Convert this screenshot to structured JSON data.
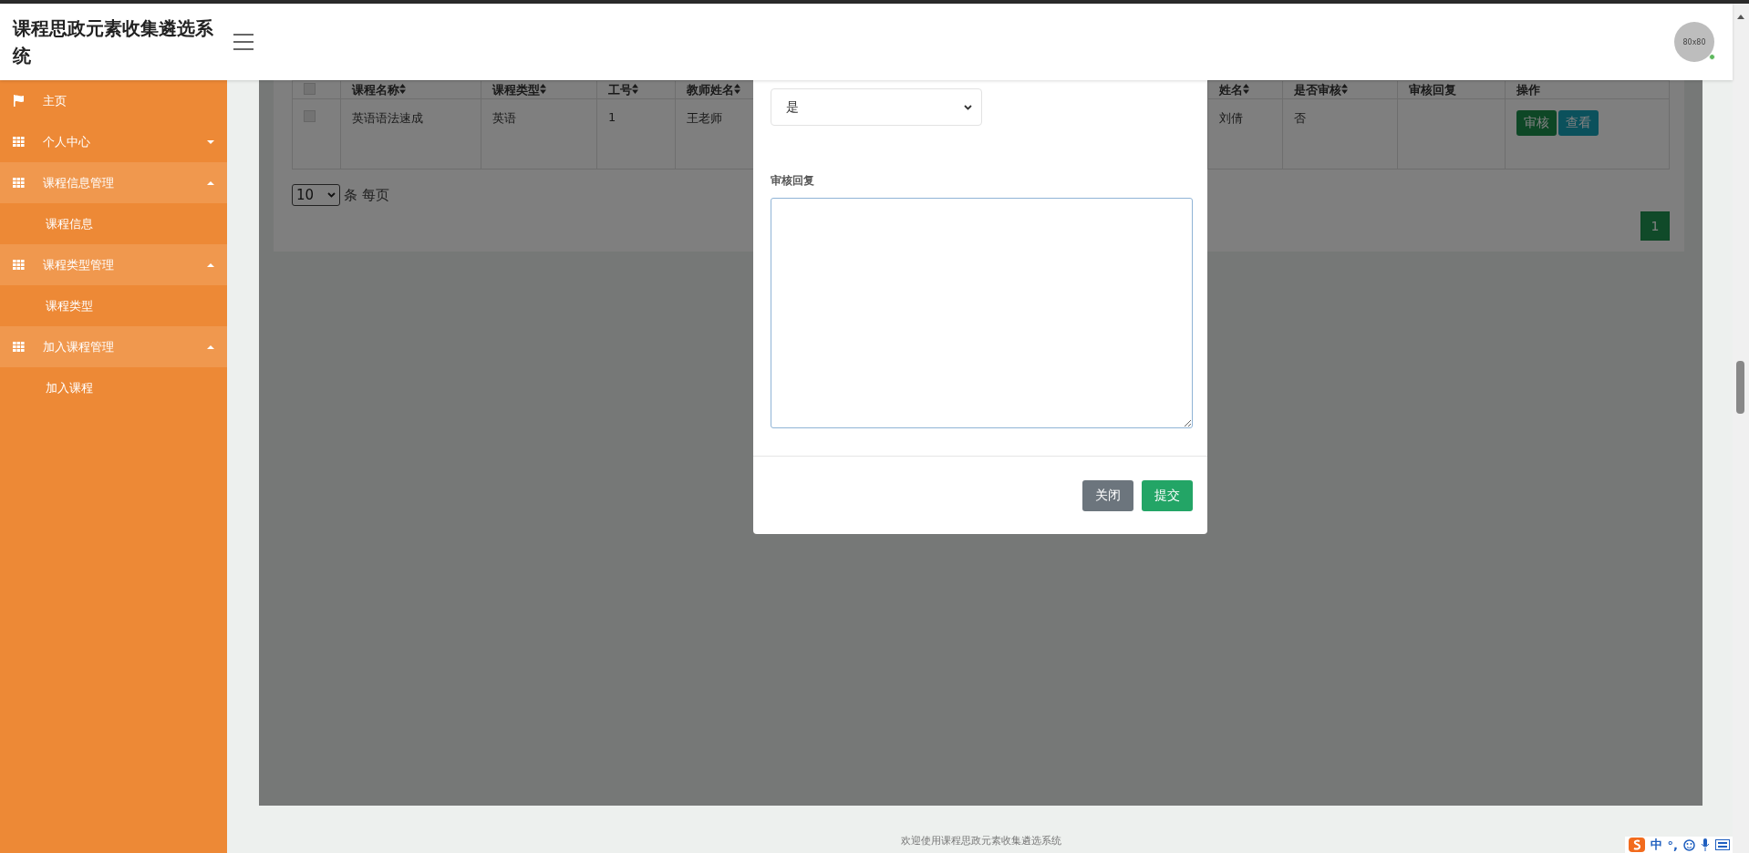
{
  "header": {
    "title": "课程思政元素收集遴选系统",
    "avatar": {
      "label": "80x80",
      "online": true
    }
  },
  "sidebar": {
    "items": [
      {
        "label": "主页",
        "kind": "home"
      },
      {
        "label": "个人中心",
        "kind": "group",
        "expanded": false
      },
      {
        "label": "课程信息管理",
        "kind": "group",
        "expanded": true,
        "children": [
          {
            "label": "课程信息"
          }
        ]
      },
      {
        "label": "课程类型管理",
        "kind": "group",
        "expanded": true,
        "children": [
          {
            "label": "课程类型"
          }
        ]
      },
      {
        "label": "加入课程管理",
        "kind": "group",
        "expanded": true,
        "children": [
          {
            "label": "加入课程"
          }
        ]
      }
    ]
  },
  "table": {
    "header_checked": false,
    "columns": [
      {
        "label": "课程名称",
        "sortable": true
      },
      {
        "label": "课程类型",
        "sortable": true
      },
      {
        "label": "工号",
        "sortable": true
      },
      {
        "label": "教师姓名",
        "sortable": true
      },
      {
        "label": "姓名",
        "sortable": true
      },
      {
        "label": "是否审核",
        "sortable": true
      },
      {
        "label": "审核回复",
        "sortable": false
      },
      {
        "label": "操作",
        "sortable": false
      }
    ],
    "rows": [
      {
        "checked": false,
        "cells": [
          "英语语法速成",
          "英语",
          "1",
          "王老师",
          "刘倩",
          "否"
        ],
        "actions": [
          {
            "label": "审核",
            "kind": "review"
          },
          {
            "label": "查看",
            "kind": "view"
          }
        ]
      }
    ]
  },
  "page_size": {
    "value": "10",
    "suffix": "条 每页"
  },
  "pagination": [
    {
      "label": "1",
      "selected": true
    }
  ],
  "dialog": {
    "select_value": "是",
    "field_label": "审核回复",
    "reply_focused": true,
    "buttons": [
      {
        "label": "关闭",
        "kind": "secondary"
      },
      {
        "label": "提交",
        "kind": "primary"
      }
    ]
  },
  "footer": {
    "text": "欢迎使用课程思政元素收集遴选系统"
  },
  "ime": {
    "label": "中",
    "punct": "°,"
  }
}
